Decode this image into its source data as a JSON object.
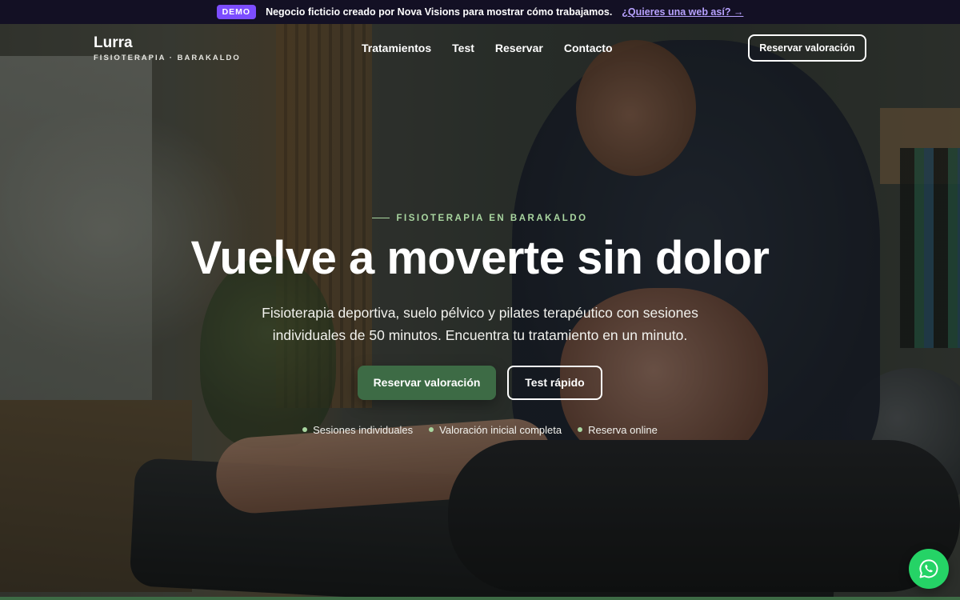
{
  "demo_bar": {
    "badge": "DEMO",
    "text": "Negocio ficticio creado por Nova Visions para mostrar cómo trabajamos.",
    "link": "¿Quieres una web así? →"
  },
  "brand": {
    "name": "Lurra",
    "tagline": "FISIOTERAPIA · BARAKALDO"
  },
  "nav": {
    "links": [
      "Tratamientos",
      "Test",
      "Reservar",
      "Contacto"
    ],
    "cta": "Reservar valoración"
  },
  "hero": {
    "eyebrow": "FISIOTERAPIA EN BARAKALDO",
    "headline": "Vuelve a moverte sin dolor",
    "subtitle": "Fisioterapia deportiva, suelo pélvico y pilates terapéutico con sesiones individuales de 50 minutos. Encuentra tu tratamiento en un minuto.",
    "primary_cta": "Reservar valoración",
    "secondary_cta": "Test rápido",
    "features": [
      "Sesiones individuales",
      "Valoración inicial completa",
      "Reserva online"
    ]
  },
  "whatsapp": {
    "icon": "whatsapp-icon"
  },
  "colors": {
    "demo_badge": "#7c4dff",
    "demo_link": "#b8a2ff",
    "accent_green": "#3d6b45",
    "eyebrow_green": "#a9d6a0",
    "whatsapp": "#25d366"
  }
}
